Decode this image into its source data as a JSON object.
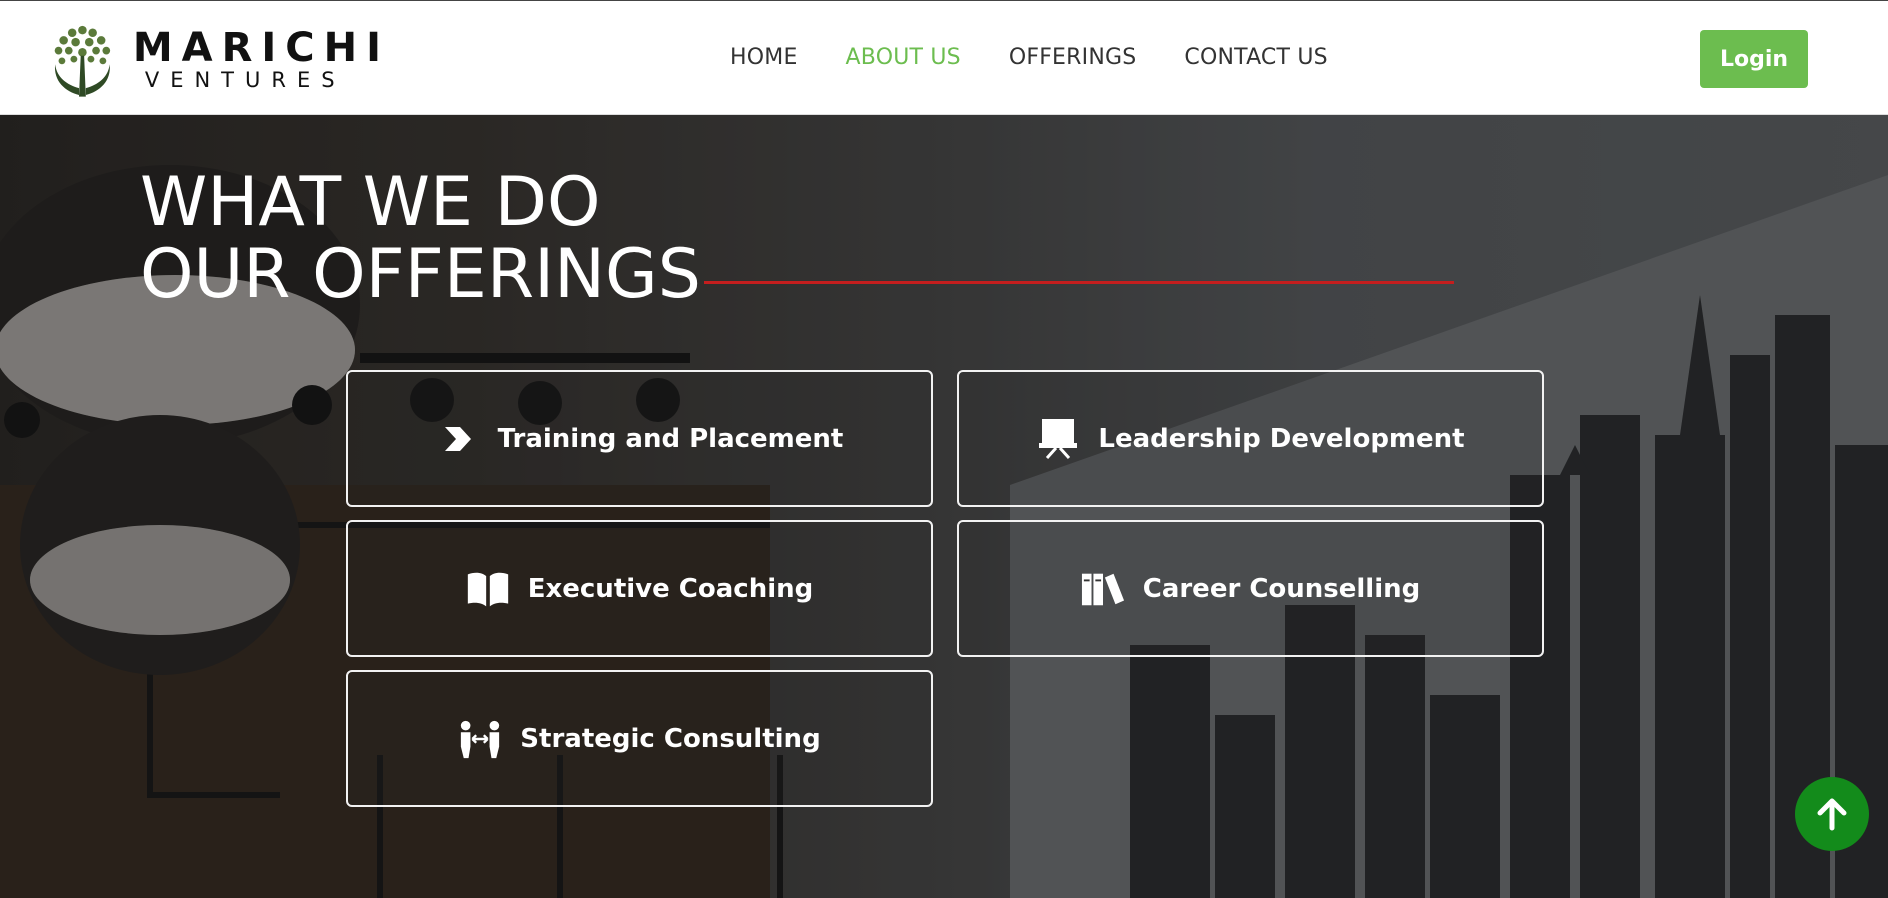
{
  "brand": {
    "name": "MARICHI",
    "tagline": "VENTURES",
    "accent": "#6cbd4f",
    "logo_icon": "tree-hands-icon"
  },
  "nav": {
    "items": [
      {
        "label": "HOME",
        "active": false
      },
      {
        "label": "ABOUT US",
        "active": true
      },
      {
        "label": "OFFERINGS",
        "active": false
      },
      {
        "label": "CONTACT US",
        "active": false
      }
    ]
  },
  "header": {
    "login_label": "Login"
  },
  "hero": {
    "heading_line1": "WHAT WE DO",
    "heading_line2": "OUR OFFERINGS",
    "rule_color": "#c41e1e"
  },
  "offerings": [
    {
      "label": "Training and Placement",
      "icon": "chevron-right-icon"
    },
    {
      "label": "Leadership Development",
      "icon": "presentation-board-icon"
    },
    {
      "label": "Executive Coaching",
      "icon": "open-book-icon"
    },
    {
      "label": "Career Counselling",
      "icon": "books-icon"
    },
    {
      "label": "Strategic Consulting",
      "icon": "people-exchange-icon"
    }
  ],
  "scroll_top": {
    "icon": "arrow-up-icon",
    "color": "#138b1b"
  }
}
